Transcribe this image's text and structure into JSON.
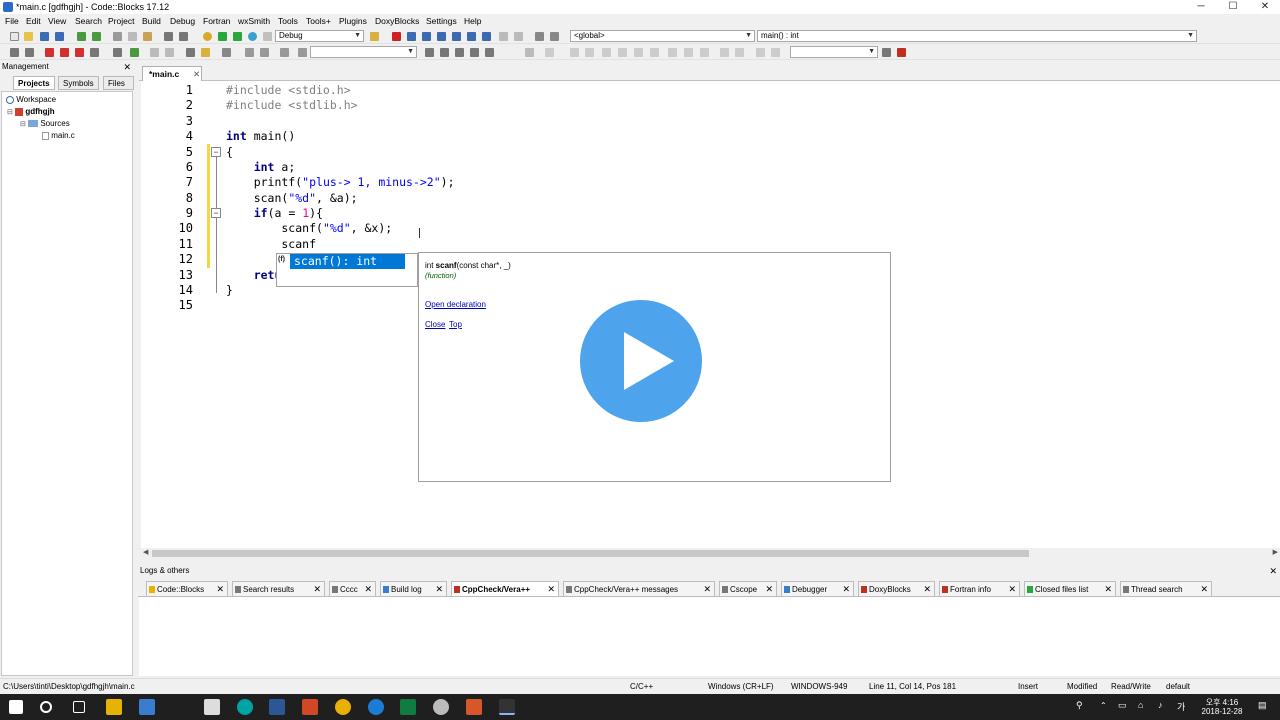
{
  "window": {
    "title": "*main.c [gdfhgjh] - Code::Blocks 17.12",
    "minimize": "─",
    "maximize": "☐",
    "close": "✕"
  },
  "menu": [
    "File",
    "Edit",
    "View",
    "Search",
    "Project",
    "Build",
    "Debug",
    "Fortran",
    "wxSmith",
    "Tools",
    "Tools+",
    "Plugins",
    "DoxyBlocks",
    "Settings",
    "Help"
  ],
  "toolbar": {
    "build_target": "Debug",
    "scope": "<global>",
    "function": "main() : int"
  },
  "management": {
    "title": "Management",
    "close": "✕",
    "tabs": [
      "Projects",
      "Symbols",
      "Files"
    ],
    "tree": {
      "workspace": "Workspace",
      "project": "gdfhgjh",
      "folder": "Sources",
      "file": "main.c"
    }
  },
  "editor": {
    "tab": "*main.c",
    "tab_close": "✕",
    "line_numbers": [
      "1",
      "2",
      "3",
      "4",
      "5",
      "6",
      "7",
      "8",
      "9",
      "10",
      "11",
      "12",
      "13",
      "14",
      "15"
    ],
    "lines": [
      "#include <stdio.h>",
      "#include <stdlib.h>",
      "",
      "int main()",
      "{",
      "    int a;",
      "    printf(\"plus-> 1, minus->2\");",
      "    scan(\"%d\", &a);",
      "    if(a = 1){",
      "        scanf(\"%d\", &x);",
      "        scanf",
      "",
      "    return 0;",
      "}",
      ""
    ]
  },
  "autocomplete": {
    "icon": "(f)",
    "selected": "scanf(): int",
    "doc_signature_prefix": "int ",
    "doc_signature_name": "scanf",
    "doc_signature_args": "(const char*, _)",
    "doc_kind": "(function)",
    "open_declaration": "Open declaration",
    "close": "Close",
    "top": "Top"
  },
  "logs": {
    "title": "Logs & others",
    "close": "✕",
    "tabs": [
      "Code::Blocks",
      "Search results",
      "Cccc",
      "Build log",
      "CppCheck/Vera++",
      "CppCheck/Vera++ messages",
      "Cscope",
      "Debugger",
      "DoxyBlocks",
      "Fortran info",
      "Closed files list",
      "Thread search"
    ],
    "active_tab": "CppCheck/Vera++"
  },
  "status": {
    "path": "C:\\Users\\tinti\\Desktop\\gdfhgjh\\main.c",
    "language": "C/C++",
    "line_endings": "Windows (CR+LF)",
    "encoding": "WINDOWS-949",
    "position": "Line 11, Col 14, Pos 181",
    "mode": "Insert",
    "modified": "Modified",
    "access": "Read/Write",
    "profile": "default"
  },
  "taskbar": {
    "ime": "가",
    "time": "오후 4:16",
    "date": "2018-12-28"
  },
  "colors": {
    "selection": "#0078d7",
    "play_button": "#4da3ec",
    "keyword": "#000080",
    "string": "#0000ff",
    "number": "#ff0080"
  }
}
